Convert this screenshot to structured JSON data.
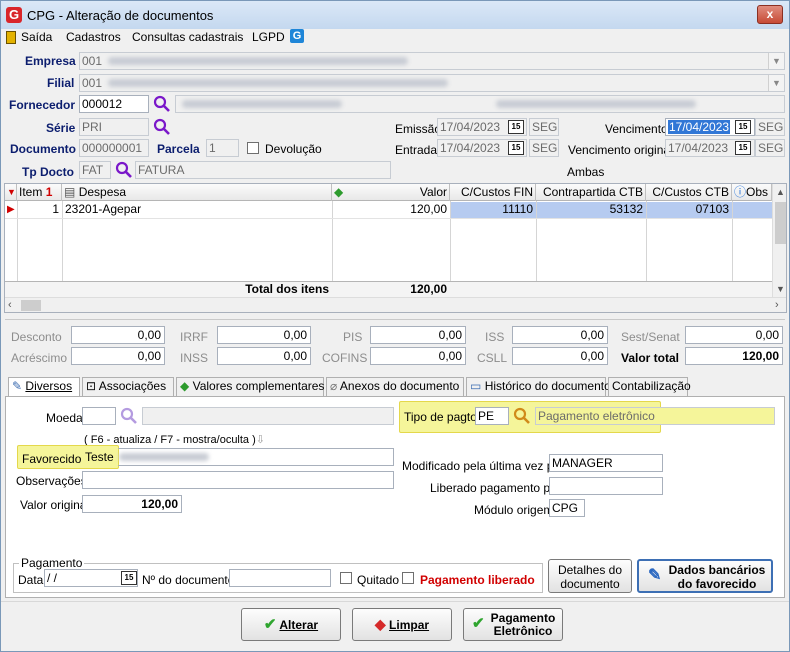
{
  "window": {
    "title": "CPG - Alteração de documentos",
    "close_label": "x"
  },
  "menu": {
    "items": [
      "Saída",
      "Cadastros",
      "Consultas cadastrais",
      "LGPD"
    ]
  },
  "header": {
    "empresa_label": "Empresa",
    "empresa_code": "001",
    "filial_label": "Filial",
    "filial_code": "001",
    "fornecedor_label": "Fornecedor",
    "fornecedor_code": "000012",
    "serie_label": "Série",
    "serie_value": "PRI",
    "documento_label": "Documento",
    "documento_value": "000000001",
    "parcela_label": "Parcela",
    "parcela_value": "1",
    "devolucao_label": "Devolução",
    "tpdocto_label": "Tp Docto",
    "tpdocto_code": "FAT",
    "tpdocto_desc": "FATURA",
    "emissao_label": "Emissão",
    "emissao_date": "17/04/2023",
    "emissao_day": "SEG",
    "entrada_label": "Entrada",
    "entrada_date": "17/04/2023",
    "entrada_day": "SEG",
    "vencimento_label": "Vencimento",
    "vencimento_date": "17/04/2023",
    "vencimento_day": "SEG",
    "vencimento_original_label": "Vencimento original",
    "vencimento_original_date": "17/04/2023",
    "vencimento_original_day": "SEG",
    "ambas_label": "Ambas",
    "cal_label": "15"
  },
  "grid": {
    "columns": [
      "Item",
      "Despesa",
      "Valor",
      "C/Custos FIN",
      "Contrapartida CTB",
      "C/Custos CTB",
      "Obs"
    ],
    "rows": [
      {
        "item": "1",
        "despesa": "23201-Agepar",
        "valor": "120,00",
        "ccfin": "11110",
        "contrapartida": "53132",
        "ccctb": "07103"
      }
    ],
    "total_label": "Total dos itens",
    "total_value": "120,00"
  },
  "taxes": {
    "desconto_label": "Desconto",
    "desconto": "0,00",
    "irrf_label": "IRRF",
    "irrf": "0,00",
    "pis_label": "PIS",
    "pis": "0,00",
    "iss_label": "ISS",
    "iss": "0,00",
    "senat_label": "Sest/Senat",
    "senat": "0,00",
    "acrescimo_label": "Acréscimo",
    "acrescimo": "0,00",
    "inss_label": "INSS",
    "inss": "0,00",
    "cofins_label": "COFINS",
    "cofins": "0,00",
    "csll_label": "CSLL",
    "csll": "0,00",
    "valor_total_label": "Valor total",
    "valor_total": "120,00"
  },
  "tabs": [
    "Diversos",
    "Associações",
    "Valores complementares",
    "Anexos do documento",
    "Histórico do documento",
    "Contabilização"
  ],
  "diversos": {
    "moeda_label": "Moeda",
    "hint": "( F6 - atualiza / F7 - mostra/oculta )",
    "favorecido_label": "Favorecido",
    "favorecido_value": "Teste",
    "observacoes_label": "Observações",
    "valor_original_label": "Valor original",
    "valor_original": "120,00",
    "tipo_pagto_label": "Tipo de pagto",
    "tipo_pagto_code": "PE",
    "tipo_pagto_desc": "Pagamento eletrônico",
    "modificado_label": "Modificado pela última vez por",
    "modificado_value": "MANAGER",
    "liberado_label": "Liberado pagamento por",
    "liberado_value": "",
    "modulo_label": "Módulo origem",
    "modulo_value": "CPG"
  },
  "pagamento": {
    "group_label": "Pagamento",
    "data_label": "Data",
    "data_value": " /  /",
    "ndoc_label": "Nº do documento",
    "quitado_label": "Quitado",
    "liberado_label": "Pagamento liberado",
    "detalhes_line1": "Detalhes do",
    "detalhes_line2": "documento",
    "bancarios_line1": "Dados bancários",
    "bancarios_line2": "do favorecido"
  },
  "footer": {
    "alterar": "Alterar",
    "limpar": "Limpar",
    "pagamento_line1": "Pagamento",
    "pagamento_line2": "Eletrônico"
  },
  "colors": {
    "accent": "#0b1d6e",
    "selection": "#b6cbf0",
    "highlight": "#f5f59a",
    "danger": "#d10000"
  }
}
